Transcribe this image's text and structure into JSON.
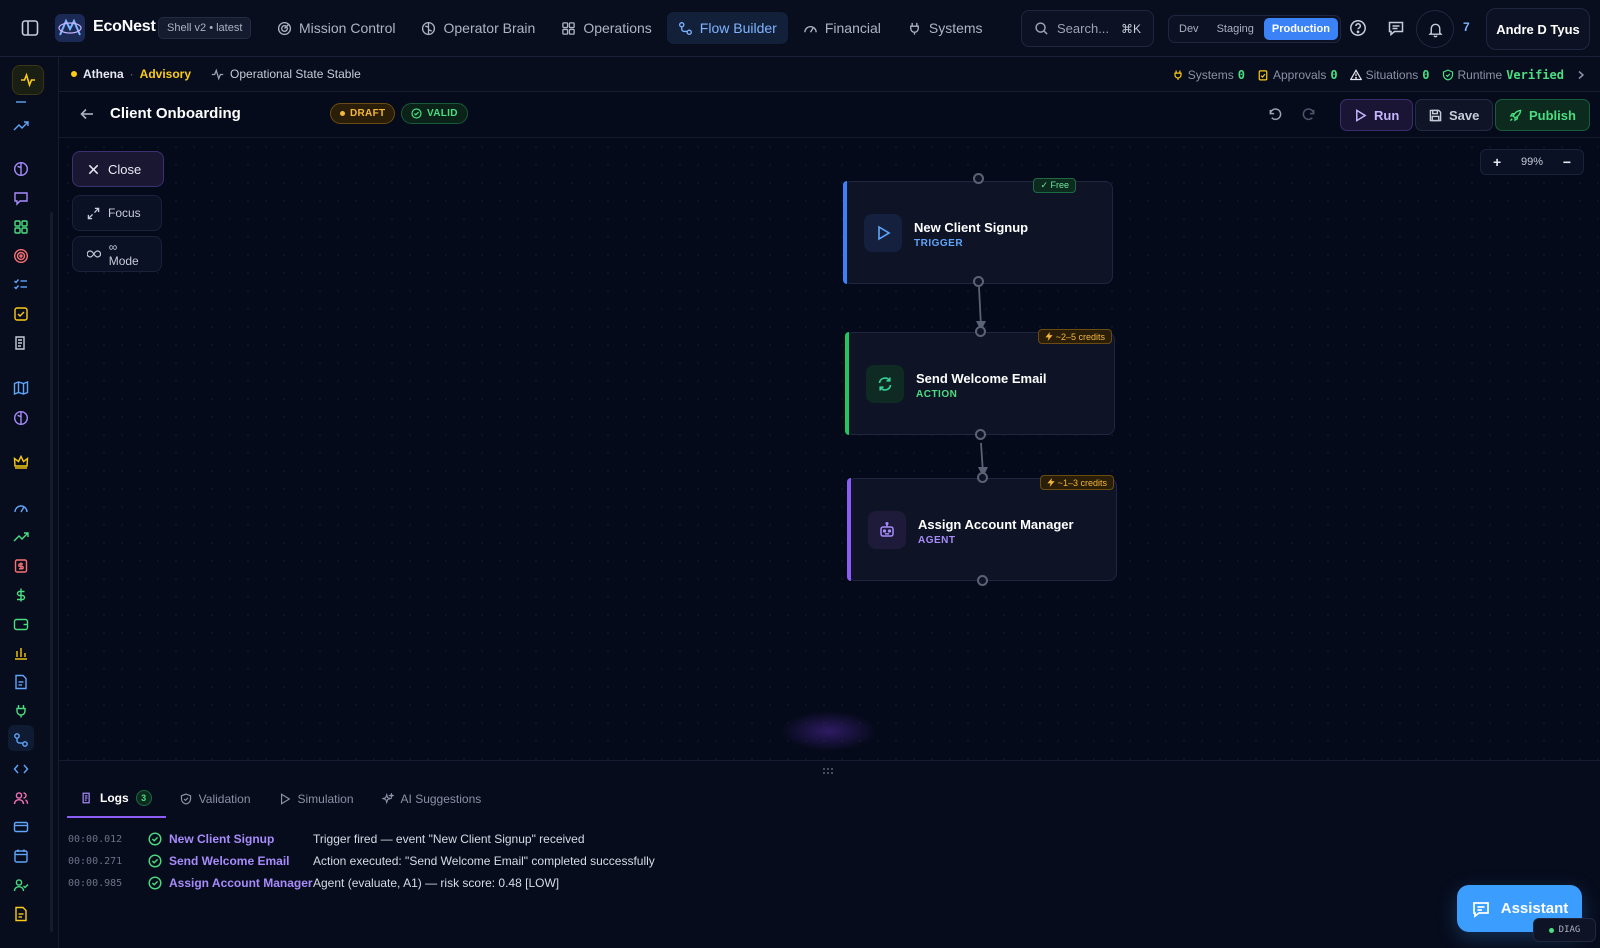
{
  "app": {
    "brand": "EcoNest",
    "shell_version": "Shell v2 • latest"
  },
  "nav": {
    "items": [
      {
        "label": "Mission Control",
        "icon": "radar-icon",
        "active": false
      },
      {
        "label": "Operator Brain",
        "icon": "brain-icon",
        "active": false
      },
      {
        "label": "Operations",
        "icon": "grid-icon",
        "active": false
      },
      {
        "label": "Flow Builder",
        "icon": "flow-icon",
        "active": true
      },
      {
        "label": "Financial",
        "icon": "gauge-icon",
        "active": false
      },
      {
        "label": "Systems",
        "icon": "plug-icon",
        "active": false
      }
    ],
    "search_placeholder": "Search...",
    "search_shortcut": "⌘K",
    "environments": [
      "Dev",
      "Staging",
      "Production"
    ],
    "active_environment": "Production",
    "notification_count": "7",
    "user_name": "Andre D Tyus"
  },
  "status": {
    "agent": "Athena",
    "mode": "Advisory",
    "state": "Operational State Stable",
    "systems_label": "Systems",
    "systems_value": "0",
    "approvals_label": "Approvals",
    "approvals_value": "0",
    "situations_label": "Situations",
    "situations_value": "0",
    "runtime_label": "Runtime",
    "runtime_value": "Verified"
  },
  "editor": {
    "title": "Client Onboarding",
    "draft_badge": "DRAFT",
    "valid_badge": "VALID",
    "run_label": "Run",
    "save_label": "Save",
    "publish_label": "Publish"
  },
  "canvas": {
    "close_label": "Close",
    "focus_label": "Focus",
    "mode_label": "∞ Mode",
    "zoom_in": "+",
    "zoom_level": "99%",
    "zoom_out": "−",
    "nodes": [
      {
        "title": "New Client Signup",
        "kind": "TRIGGER",
        "tag": "✓ Free",
        "accent": "#3b82f6"
      },
      {
        "title": "Send Welcome Email",
        "kind": "ACTION",
        "tag": "~2–5 credits",
        "accent": "#22c55e"
      },
      {
        "title": "Assign Account Manager",
        "kind": "AGENT",
        "tag": "~1–3 credits",
        "accent": "#8b5cf6"
      }
    ]
  },
  "panel": {
    "tabs": [
      {
        "label": "Logs",
        "count": "3",
        "active": true
      },
      {
        "label": "Validation",
        "active": false
      },
      {
        "label": "Simulation",
        "active": false
      },
      {
        "label": "AI Suggestions",
        "active": false
      }
    ],
    "logs": [
      {
        "time": "00:00.012",
        "node": "New Client Signup",
        "message": "Trigger fired — event \"New Client Signup\" received"
      },
      {
        "time": "00:00.271",
        "node": "Send Welcome Email",
        "message": "Action executed: \"Send Welcome Email\" completed successfully"
      },
      {
        "time": "00:00.985",
        "node": "Assign Account Manager",
        "message": "Agent (evaluate, A1) — risk score: 0.48 [LOW]"
      }
    ]
  },
  "assistant_label": "Assistant",
  "diag_label": "DIAG"
}
